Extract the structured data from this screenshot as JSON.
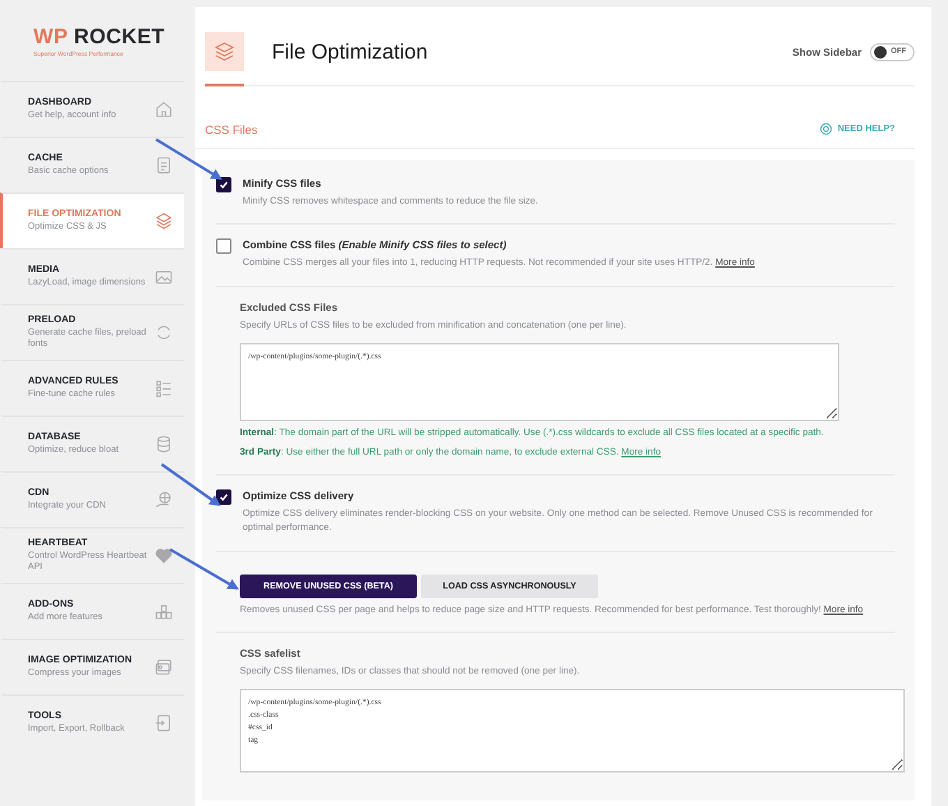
{
  "logo": {
    "brand_a": "WP",
    "brand_b": "ROCKET",
    "tagline": "Superior WordPress Performance"
  },
  "sidebar": {
    "items": [
      {
        "title": "DASHBOARD",
        "subtitle": "Get help, account info",
        "selected": false
      },
      {
        "title": "CACHE",
        "subtitle": "Basic cache options",
        "selected": false
      },
      {
        "title": "FILE OPTIMIZATION",
        "subtitle": "Optimize CSS & JS",
        "selected": true
      },
      {
        "title": "MEDIA",
        "subtitle": "LazyLoad, image dimensions",
        "selected": false
      },
      {
        "title": "PRELOAD",
        "subtitle": "Generate cache files, preload fonts",
        "selected": false
      },
      {
        "title": "ADVANCED RULES",
        "subtitle": "Fine-tune cache rules",
        "selected": false
      },
      {
        "title": "DATABASE",
        "subtitle": "Optimize, reduce bloat",
        "selected": false
      },
      {
        "title": "CDN",
        "subtitle": "Integrate your CDN",
        "selected": false
      },
      {
        "title": "HEARTBEAT",
        "subtitle": "Control WordPress Heartbeat API",
        "selected": false
      },
      {
        "title": "ADD-ONS",
        "subtitle": "Add more features",
        "selected": false
      },
      {
        "title": "IMAGE OPTIMIZATION",
        "subtitle": "Compress your images",
        "selected": false
      },
      {
        "title": "TOOLS",
        "subtitle": "Import, Export, Rollback",
        "selected": false
      }
    ]
  },
  "header": {
    "title": "File Optimization",
    "sidebar_toggle": {
      "label": "Show Sidebar",
      "on": false,
      "state": "OFF"
    }
  },
  "section": {
    "title": "CSS Files",
    "help": "NEED HELP?"
  },
  "settings": [
    {
      "kind": "checkbox",
      "label": "Minify CSS files",
      "checked": true,
      "description": "Minify CSS removes whitespace and comments to reduce the file size."
    },
    {
      "kind": "checkbox",
      "label": "Combine CSS files",
      "note": "(Enable Minify CSS files to select)",
      "checked": false,
      "description": "Combine CSS merges all your files into 1, reducing HTTP requests. Not recommended if your site uses HTTP/2.",
      "link": "More info"
    },
    {
      "kind": "textarea",
      "label": "Excluded CSS Files",
      "description": "Specify URLs of CSS files to be excluded from minification and concatenation (one per line).",
      "value": "/wp-content/plugins/some-plugin/(.*).css",
      "hints": [
        {
          "text": "**Internal**: The domain part of the URL will be stripped automatically. Use (.*).css wildcards to exclude all CSS files located at a specific path."
        },
        {
          "text": "**3rd Party**: Use either the full URL path or only the domain name, to exclude external CSS.",
          "link": "More info"
        }
      ]
    },
    {
      "kind": "checkbox",
      "label": "Optimize CSS delivery",
      "checked": true,
      "description": "Optimize CSS delivery eliminates render-blocking CSS on your website. Only one method can be selected. Remove Unused CSS is recommended for optimal performance."
    },
    {
      "kind": "choice",
      "options": [
        {
          "label": "REMOVE UNUSED CSS (BETA)",
          "selected": true
        },
        {
          "label": "LOAD CSS ASYNCHRONOUSLY",
          "selected": false
        }
      ],
      "description": "Removes unused CSS per page and helps to reduce page size and HTTP requests. Recommended for best performance. Test thoroughly!",
      "link": "More info"
    },
    {
      "kind": "textarea",
      "label": "CSS safelist",
      "description": "Specify CSS filenames, IDs or classes that should not be removed (one per line).",
      "value": "/wp-content/plugins/some-plugin/(.*).css\n.css-class\n#css_id\ntag"
    }
  ]
}
